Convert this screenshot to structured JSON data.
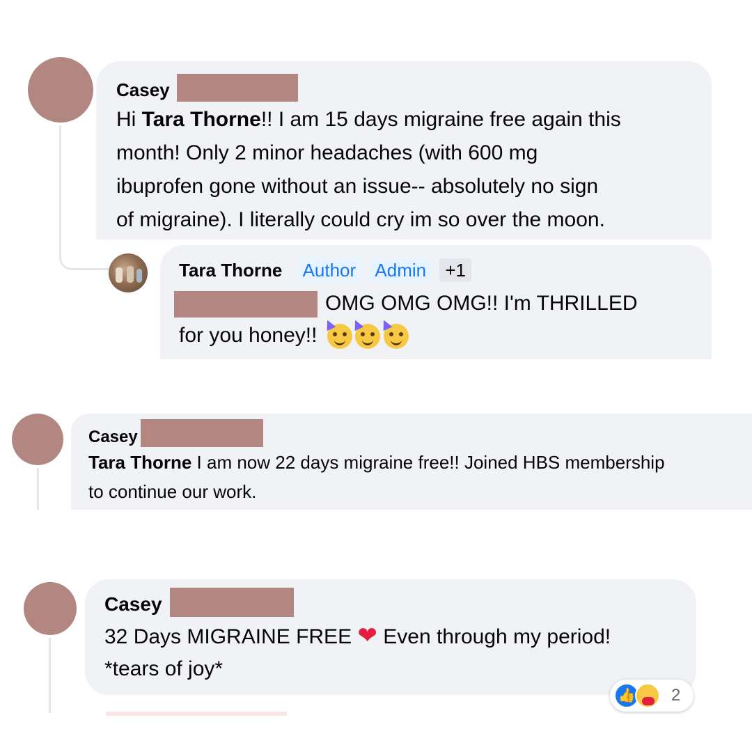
{
  "comments": [
    {
      "author_first": "Casey",
      "line1_mention": "Tara Thorne",
      "line1_rest": "!! I am 15 days migraine free again this",
      "line2": "month! Only 2 minor headaches (with 600 mg",
      "line3": "ibuprofen gone without an issue-- absolutely no sign",
      "line4": "of migraine). I literally could cry im so over the moon.",
      "reply": {
        "author": "Tara Thorne",
        "badges": [
          "Author",
          "Admin",
          "+1"
        ],
        "line1": "OMG OMG OMG!! I'm THRILLED",
        "line2": "for you honey!!",
        "emoji": [
          "partying-face",
          "partying-face",
          "partying-face"
        ]
      }
    },
    {
      "author_first": "Casey",
      "mention": "Tara Thorne",
      "line1_rest": " I am now 22 days migraine free!! Joined HBS membership",
      "line2": "to continue our work."
    },
    {
      "author_first": "Casey",
      "line1_before": "32 Days MIGRAINE FREE ",
      "line1_after": " Even through my period!",
      "line2": "*tears of joy*",
      "reactions": {
        "icons": [
          "like-icon",
          "care-icon"
        ],
        "count": "2"
      }
    }
  ],
  "colors": {
    "redaction": "#b38781",
    "bubble": "#f0f2f5",
    "badge_blue": "#1877f2",
    "heart": "#e41e3f"
  }
}
